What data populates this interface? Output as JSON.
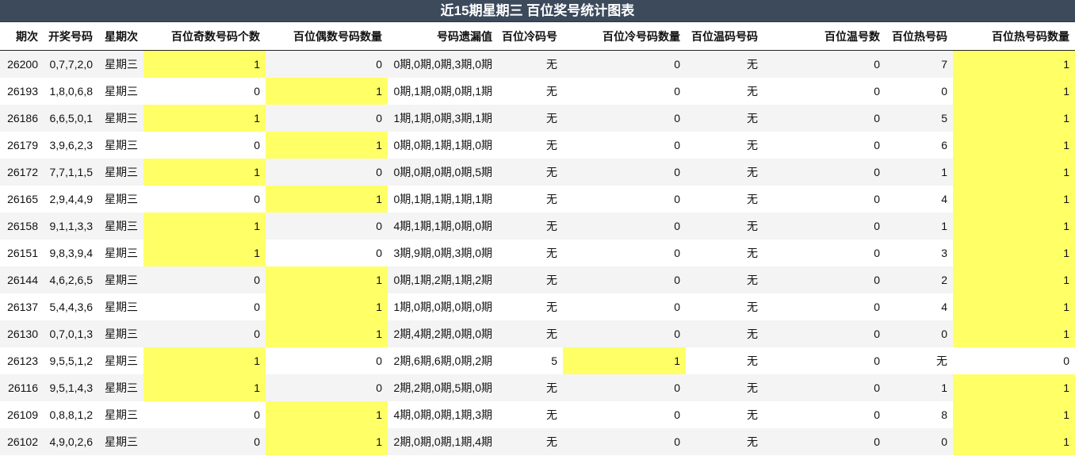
{
  "title": "近15期星期三 百位奖号统计图表",
  "colors": {
    "header_bg": "#3c4a5c",
    "highlight": "#ffff66",
    "stripe": "#f4f4f4"
  },
  "columns": [
    "期次",
    "开奖号码",
    "星期次",
    "百位奇数号码个数",
    "百位偶数号码数量",
    "号码遗漏值",
    "百位冷码号",
    "百位冷号码数量",
    "百位温码号码",
    "百位温号数",
    "百位热号码",
    "百位热号码数量"
  ],
  "rows": [
    [
      "26200",
      "0,7,7,2,0",
      "星期三",
      "1",
      "0",
      "0期,0期,0期,3期,0期",
      "无",
      "0",
      "无",
      "0",
      "7",
      "1"
    ],
    [
      "26193",
      "1,8,0,6,8",
      "星期三",
      "0",
      "1",
      "0期,1期,0期,0期,1期",
      "无",
      "0",
      "无",
      "0",
      "0",
      "1"
    ],
    [
      "26186",
      "6,6,5,0,1",
      "星期三",
      "1",
      "0",
      "1期,1期,0期,3期,1期",
      "无",
      "0",
      "无",
      "0",
      "5",
      "1"
    ],
    [
      "26179",
      "3,9,6,2,3",
      "星期三",
      "0",
      "1",
      "0期,0期,1期,1期,0期",
      "无",
      "0",
      "无",
      "0",
      "6",
      "1"
    ],
    [
      "26172",
      "7,7,1,1,5",
      "星期三",
      "1",
      "0",
      "0期,0期,0期,0期,5期",
      "无",
      "0",
      "无",
      "0",
      "1",
      "1"
    ],
    [
      "26165",
      "2,9,4,4,9",
      "星期三",
      "0",
      "1",
      "0期,1期,1期,1期,1期",
      "无",
      "0",
      "无",
      "0",
      "4",
      "1"
    ],
    [
      "26158",
      "9,1,1,3,3",
      "星期三",
      "1",
      "0",
      "4期,1期,1期,0期,0期",
      "无",
      "0",
      "无",
      "0",
      "1",
      "1"
    ],
    [
      "26151",
      "9,8,3,9,4",
      "星期三",
      "1",
      "0",
      "3期,9期,0期,3期,0期",
      "无",
      "0",
      "无",
      "0",
      "3",
      "1"
    ],
    [
      "26144",
      "4,6,2,6,5",
      "星期三",
      "0",
      "1",
      "0期,1期,2期,1期,2期",
      "无",
      "0",
      "无",
      "0",
      "2",
      "1"
    ],
    [
      "26137",
      "5,4,4,3,6",
      "星期三",
      "0",
      "1",
      "1期,0期,0期,0期,0期",
      "无",
      "0",
      "无",
      "0",
      "4",
      "1"
    ],
    [
      "26130",
      "0,7,0,1,3",
      "星期三",
      "0",
      "1",
      "2期,4期,2期,0期,0期",
      "无",
      "0",
      "无",
      "0",
      "0",
      "1"
    ],
    [
      "26123",
      "9,5,5,1,2",
      "星期三",
      "1",
      "0",
      "2期,6期,6期,0期,2期",
      "5",
      "1",
      "无",
      "0",
      "无",
      "0"
    ],
    [
      "26116",
      "9,5,1,4,3",
      "星期三",
      "1",
      "0",
      "2期,2期,0期,5期,0期",
      "无",
      "0",
      "无",
      "0",
      "1",
      "1"
    ],
    [
      "26109",
      "0,8,8,1,2",
      "星期三",
      "0",
      "1",
      "4期,0期,0期,1期,3期",
      "无",
      "0",
      "无",
      "0",
      "8",
      "1"
    ],
    [
      "26102",
      "4,9,0,2,6",
      "星期三",
      "0",
      "1",
      "2期,0期,0期,1期,4期",
      "无",
      "0",
      "无",
      "0",
      "0",
      "1"
    ]
  ]
}
